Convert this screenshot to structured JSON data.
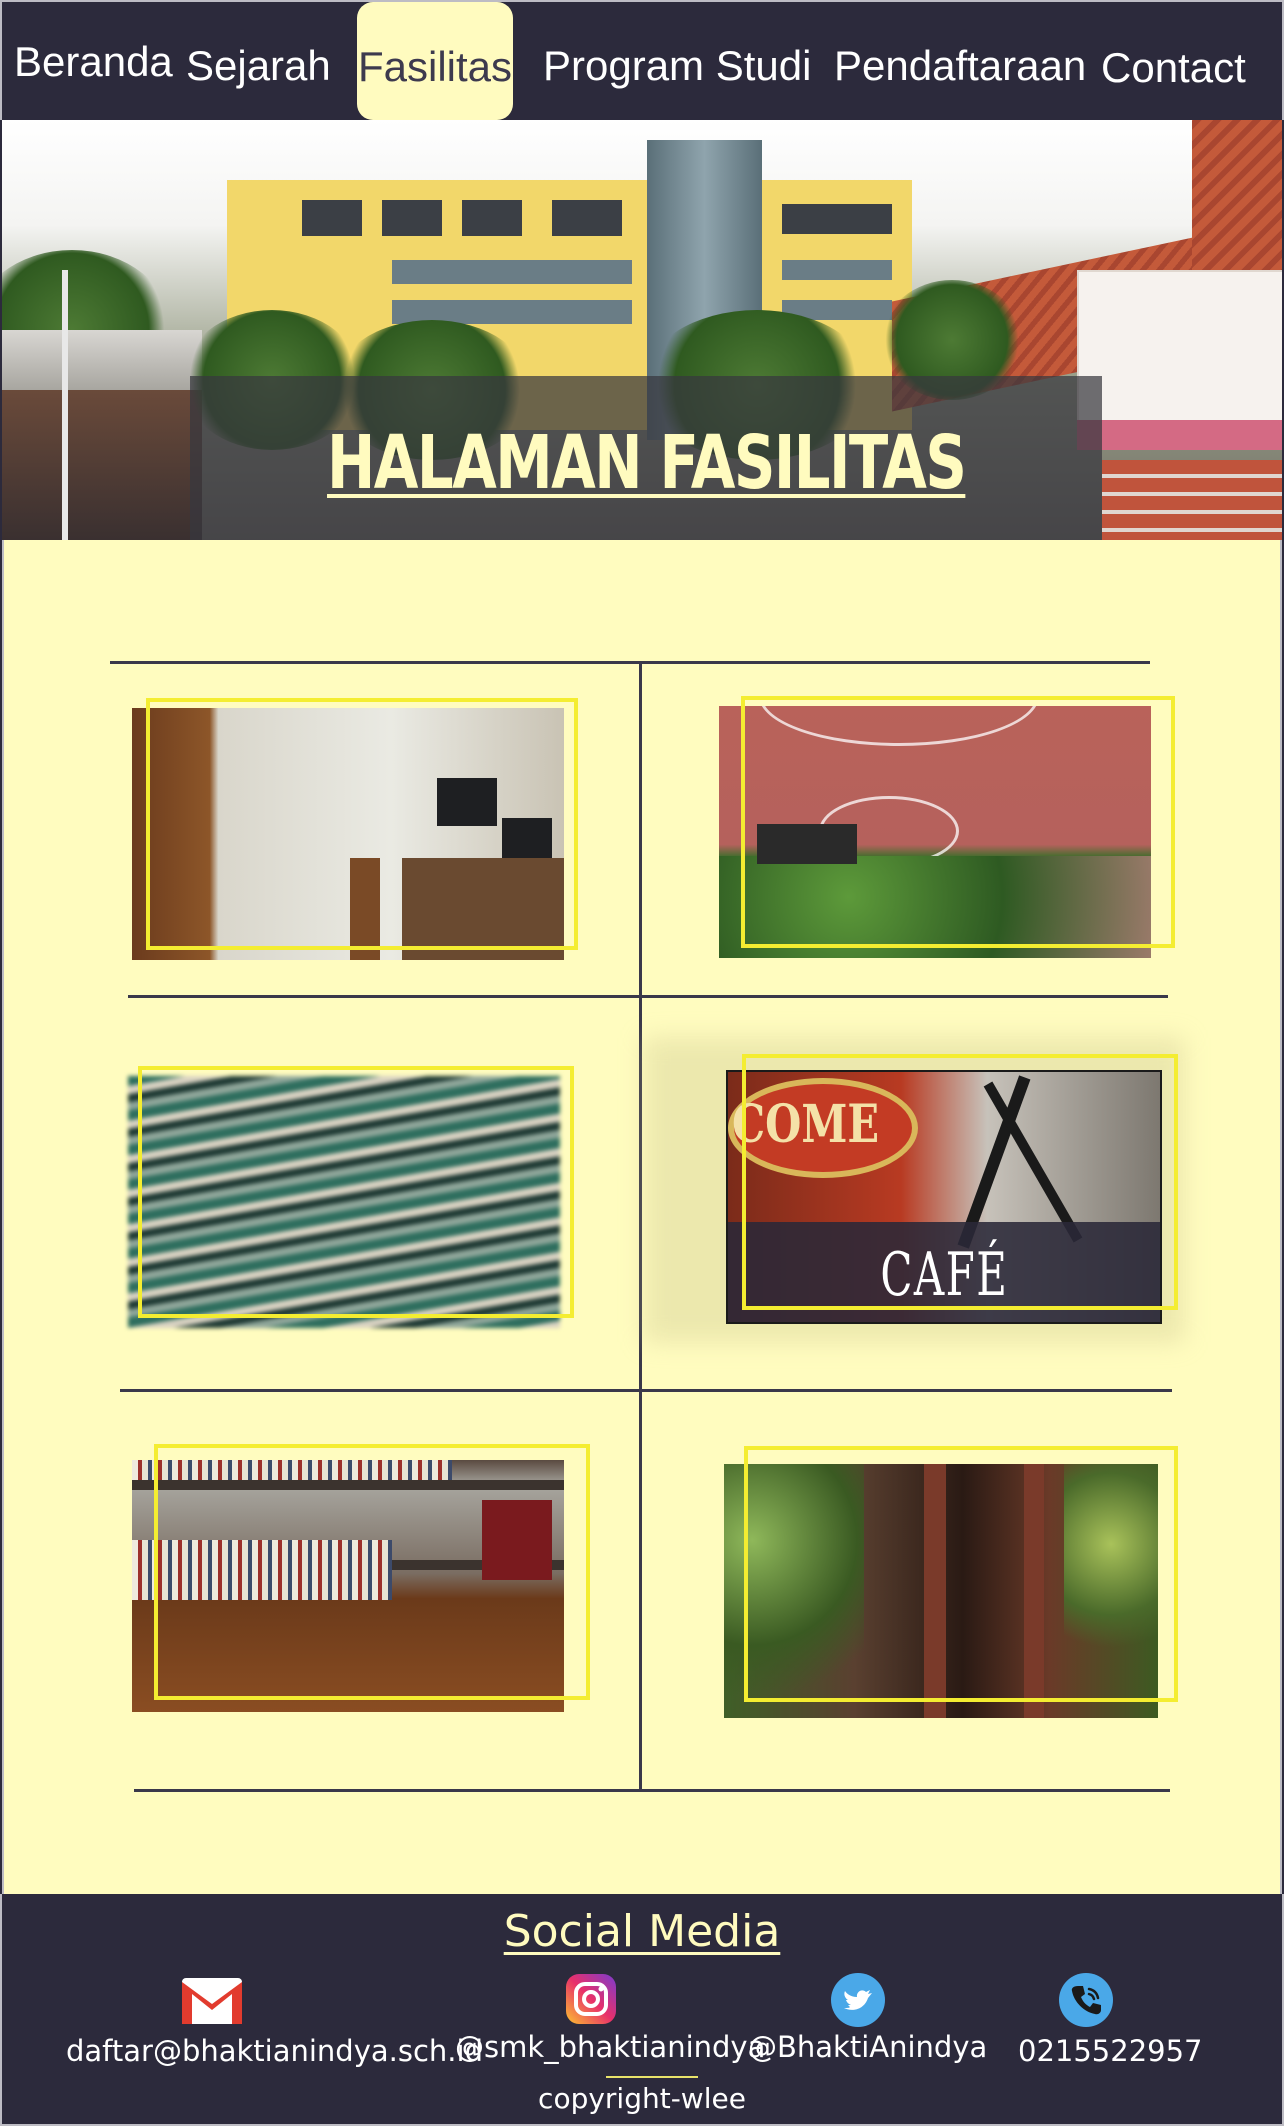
{
  "nav": {
    "items": [
      {
        "label": "Beranda"
      },
      {
        "label": "Sejarah"
      },
      {
        "label": "Fasilitas",
        "active": true
      },
      {
        "label": "Program Studi"
      },
      {
        "label": "Pendaftaraan"
      },
      {
        "label": "Contact"
      }
    ]
  },
  "hero": {
    "title": "HALAMAN FASILITAS"
  },
  "gallery": {
    "cafe_label": "CAFÉ",
    "photos": [
      {
        "subject": "computer-lab"
      },
      {
        "subject": "basketball-court"
      },
      {
        "subject": "prayer-room-carpet"
      },
      {
        "subject": "cafe"
      },
      {
        "subject": "library"
      },
      {
        "subject": "hall"
      }
    ]
  },
  "footer": {
    "title": "Social Media",
    "email": "daftar@bhaktianindya.sch.id",
    "instagram": "@smk_bhaktianindya",
    "twitter": "@BhaktiAnindya",
    "phone": "0215522957",
    "copyright": "copyright-wlee"
  },
  "colors": {
    "nav_bg": "#2c2a3c",
    "accent_cream": "#fffbbf",
    "page_bg": "#fffcbf",
    "frame_yellow": "#f4ed31",
    "divider": "#3a384a"
  }
}
